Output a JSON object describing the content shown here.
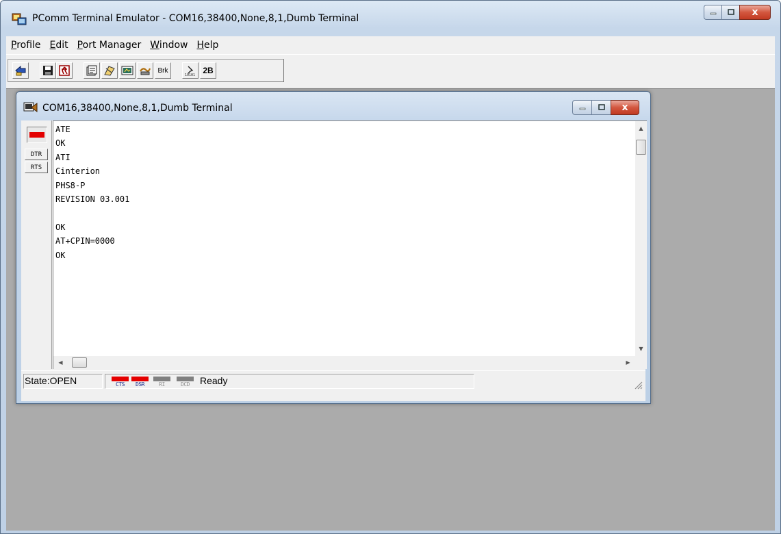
{
  "app": {
    "title": "PComm Terminal Emulator - COM16,38400,None,8,1,Dumb Terminal",
    "icon": "pcomm-app-icon",
    "close_glyph": "x"
  },
  "menu": {
    "items": [
      {
        "mnemonic": "P",
        "rest": "rofile"
      },
      {
        "mnemonic": "E",
        "rest": "dit"
      },
      {
        "mnemonic": "P",
        "rest": "ort Manager"
      },
      {
        "mnemonic": "W",
        "rest": "indow"
      },
      {
        "mnemonic": "H",
        "rest": "elp"
      }
    ]
  },
  "toolbar": {
    "buttons": [
      {
        "icon": "open-icon"
      },
      {
        "icon": "save-icon"
      },
      {
        "icon": "exit-icon"
      },
      {
        "icon": "properties-icon"
      },
      {
        "icon": "transfer-icon"
      },
      {
        "icon": "capture-icon"
      },
      {
        "icon": "connect-icon"
      },
      {
        "icon": "break-text",
        "text": "Brk"
      },
      {
        "icon": "binary-icon"
      },
      {
        "icon": "mode-text",
        "text": "2B"
      }
    ]
  },
  "terminal_window": {
    "title": "COM16,38400,None,8,1,Dumb Terminal",
    "icon": "terminal-icon",
    "lines": [
      "ATE",
      "OK",
      "ATI",
      "Cinterion",
      "PHS8-P",
      "REVISION 03.001",
      "",
      "OK",
      "AT+CPIN=0000",
      "OK"
    ],
    "line_buttons": {
      "dtr": "DTR",
      "rts": "RTS"
    },
    "led_color": "#e30000"
  },
  "status": {
    "state": "State:OPEN",
    "leds": [
      {
        "label": "CTS",
        "on": true
      },
      {
        "label": "DSR",
        "on": true
      },
      {
        "label": "RI",
        "on": false
      },
      {
        "label": "DCD",
        "on": false
      }
    ],
    "message": "Ready"
  },
  "colors": {
    "led_on": "#e50000",
    "led_off": "#808080",
    "mdi_background": "#ababab"
  }
}
